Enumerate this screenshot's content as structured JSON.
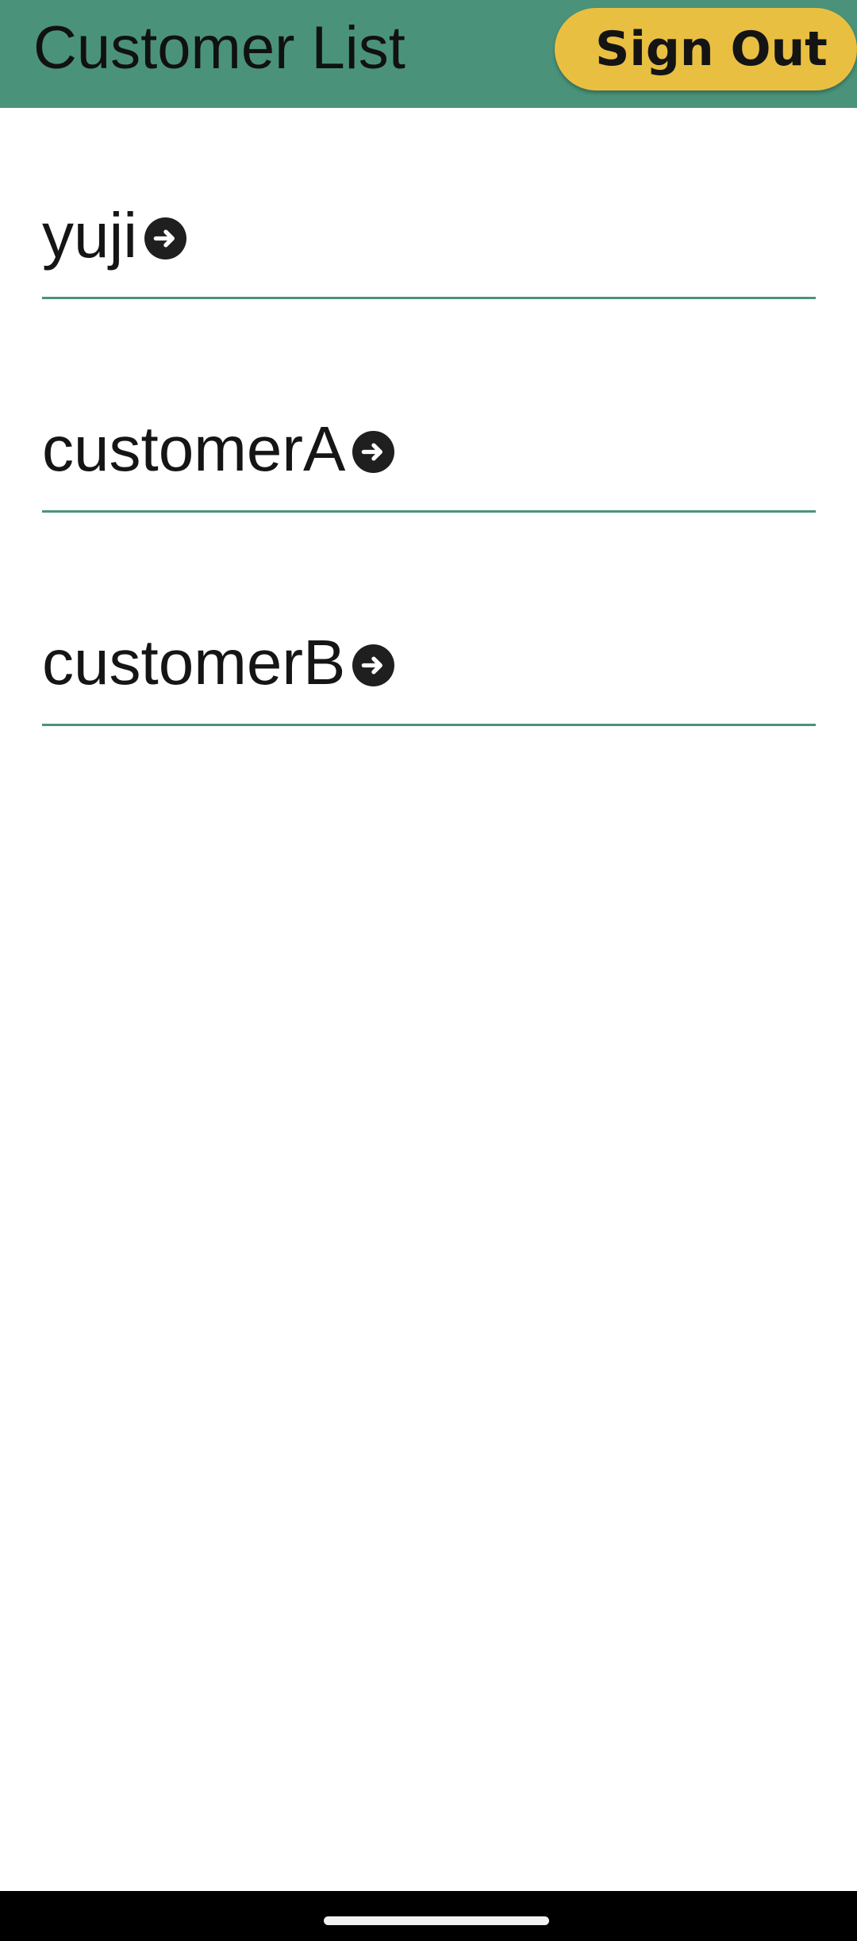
{
  "header": {
    "title": "Customer List",
    "signout_label": "Sign Out",
    "background_color": "#4a937a",
    "signout_color": "#e9bf42"
  },
  "customers": [
    {
      "name": "yuji",
      "icon": "arrow-right-circle-icon"
    },
    {
      "name": "customerA",
      "icon": "arrow-right-circle-icon"
    },
    {
      "name": "customerB",
      "icon": "arrow-right-circle-icon"
    }
  ],
  "colors": {
    "divider": "#4a937a",
    "text": "#151515",
    "nav_bar": "#000000"
  }
}
